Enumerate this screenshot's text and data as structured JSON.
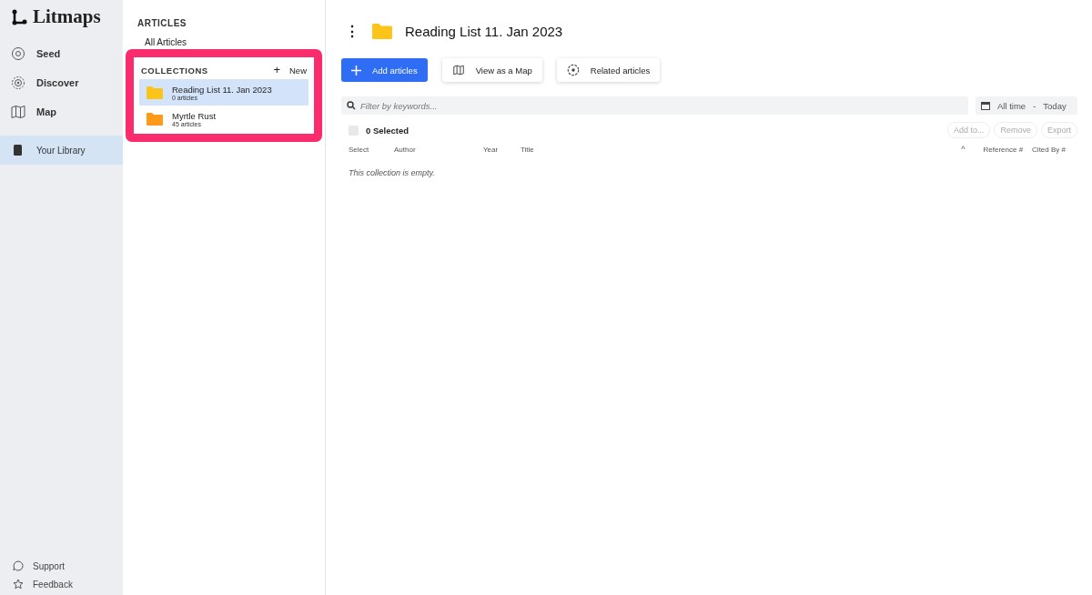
{
  "app": {
    "name": "Litmaps"
  },
  "nav": {
    "items": [
      {
        "label": "Seed",
        "selected": false
      },
      {
        "label": "Discover",
        "selected": false
      },
      {
        "label": "Map",
        "selected": false
      },
      {
        "label": "Your Library",
        "selected": true
      }
    ],
    "footer": [
      {
        "label": "Support"
      },
      {
        "label": "Feedback"
      }
    ]
  },
  "library": {
    "articles_heading": "ARTICLES",
    "all_articles": "All Articles",
    "collections_heading": "COLLECTIONS",
    "new_button": "New",
    "new_icon": "+",
    "collections": [
      {
        "name": "Reading List 11. Jan 2023",
        "count": "0 articles",
        "selected": true,
        "color": "#fcc419"
      },
      {
        "name": "Myrtle Rust",
        "count": "45 articles",
        "selected": false,
        "color": "#fd9a1c"
      }
    ]
  },
  "main": {
    "title": "Reading List 11. Jan 2023",
    "menu_icon": "⋮",
    "actions": [
      {
        "label": "Add articles",
        "kind": "primary"
      },
      {
        "label": "View as a Map",
        "kind": "map"
      },
      {
        "label": "Related articles",
        "kind": "related"
      }
    ],
    "filter": {
      "placeholder": "Filter by keywords..."
    },
    "date_range": {
      "from": "All time",
      "separator": "-",
      "to": "Today"
    },
    "selection": {
      "checked": false,
      "label": "0 Selected"
    },
    "bulk_actions": [
      "Add to...",
      "Remove",
      "Export"
    ],
    "columns_left": [
      "Select",
      "Author",
      "Year",
      "Title"
    ],
    "sort_icon": "^",
    "columns_right": [
      "Reference #",
      "Cited By #"
    ],
    "empty_message": "This collection is empty."
  }
}
